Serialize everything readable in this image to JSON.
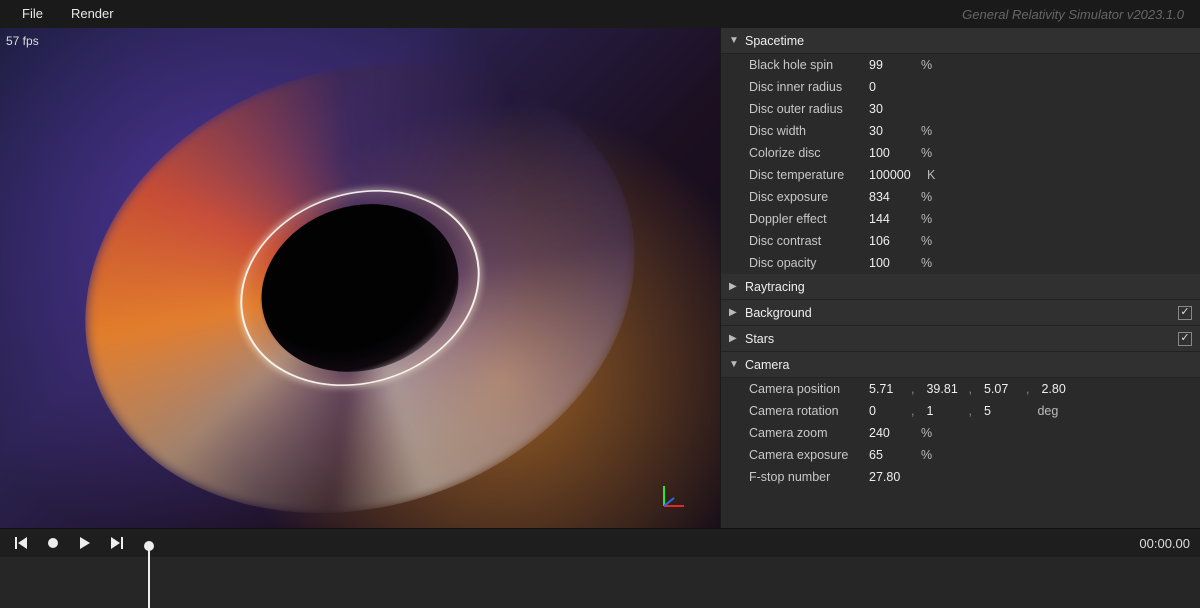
{
  "menu": {
    "file": "File",
    "render": "Render"
  },
  "version": "General Relativity Simulator v2023.1.0",
  "fps": "57 fps",
  "sections": {
    "spacetime": {
      "title": "Spacetime",
      "expanded": true,
      "params": [
        {
          "label": "Black hole spin",
          "value": "99",
          "unit": "%"
        },
        {
          "label": "Disc inner radius",
          "value": "0",
          "unit": ""
        },
        {
          "label": "Disc outer radius",
          "value": "30",
          "unit": ""
        },
        {
          "label": "Disc width",
          "value": "30",
          "unit": "%"
        },
        {
          "label": "Colorize disc",
          "value": "100",
          "unit": "%"
        },
        {
          "label": "Disc temperature",
          "value": "100000",
          "unit": "K"
        },
        {
          "label": "Disc exposure",
          "value": "834",
          "unit": "%"
        },
        {
          "label": "Doppler effect",
          "value": "144",
          "unit": "%"
        },
        {
          "label": "Disc contrast",
          "value": "106",
          "unit": "%"
        },
        {
          "label": "Disc opacity",
          "value": "100",
          "unit": "%"
        }
      ]
    },
    "raytracing": {
      "title": "Raytracing",
      "expanded": false
    },
    "background": {
      "title": "Background",
      "expanded": false,
      "checked": true
    },
    "stars": {
      "title": "Stars",
      "expanded": false,
      "checked": true
    },
    "camera": {
      "title": "Camera",
      "expanded": true,
      "position": {
        "label": "Camera position",
        "v": [
          "5.71",
          "39.81",
          "5.07",
          "2.80"
        ]
      },
      "rotation": {
        "label": "Camera rotation",
        "v": [
          "0",
          "1",
          "5"
        ],
        "unit": "deg"
      },
      "zoom": {
        "label": "Camera zoom",
        "value": "240",
        "unit": "%"
      },
      "exposure": {
        "label": "Camera exposure",
        "value": "65",
        "unit": "%"
      },
      "fstop": {
        "label": "F-stop number",
        "value": "27.80",
        "unit": ""
      }
    }
  },
  "timeline": {
    "time": "00:00.00"
  },
  "glyphs": {
    "tri_down": "▼",
    "tri_right": "▶",
    "check": "✓",
    "sep": ","
  }
}
